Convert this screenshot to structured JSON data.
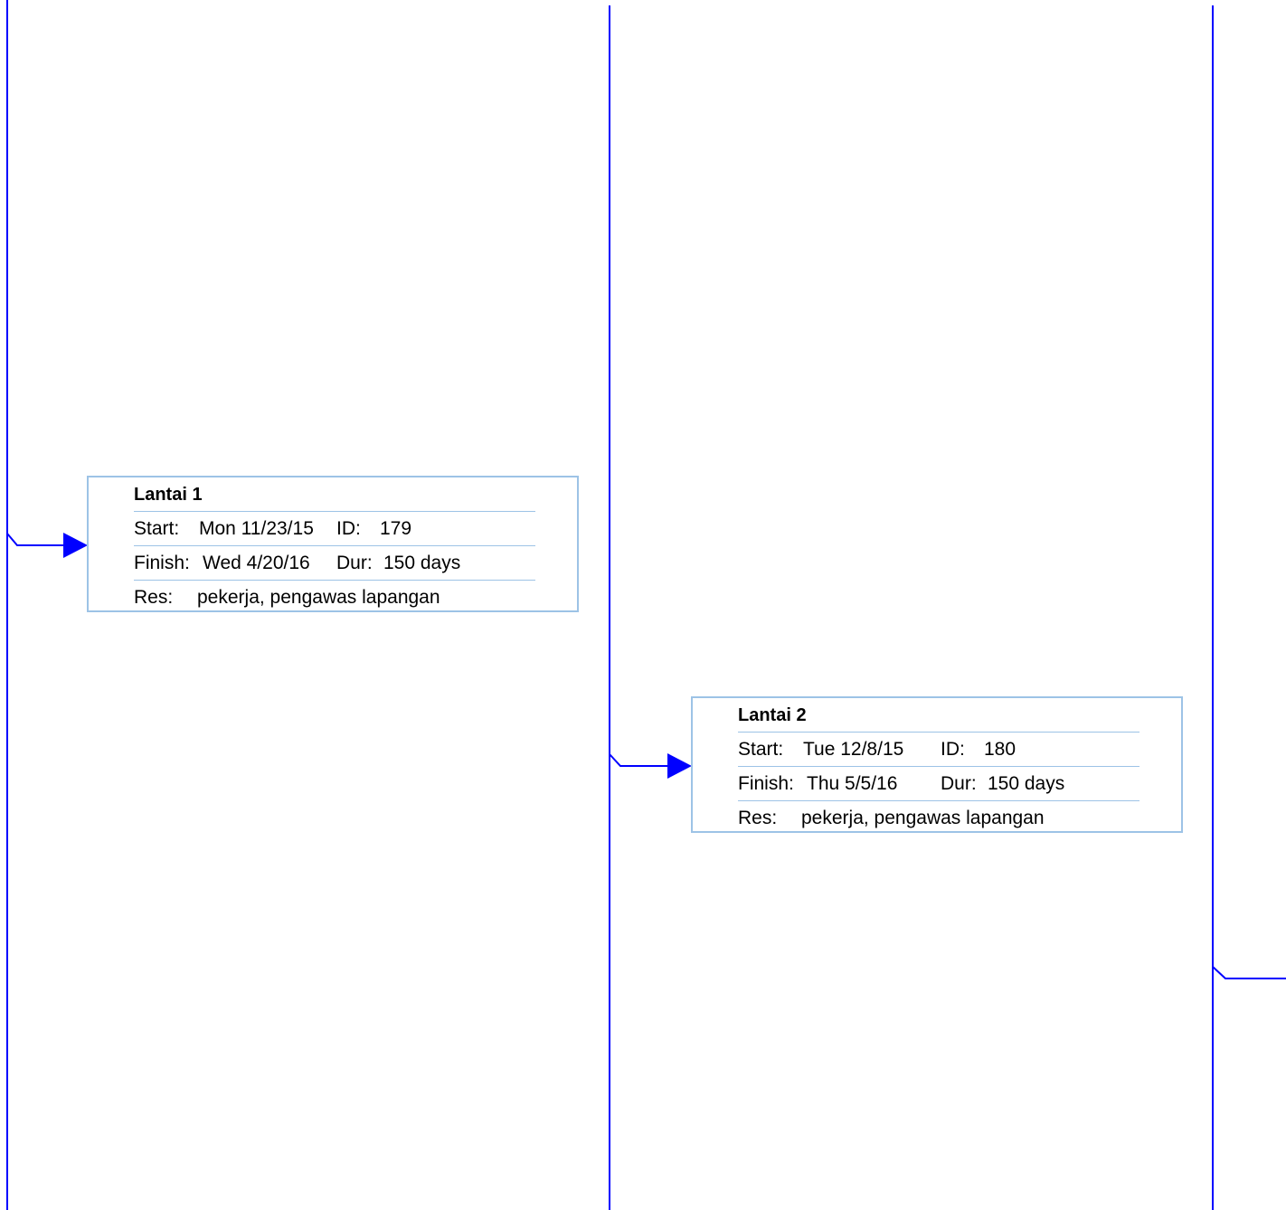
{
  "colors": {
    "connector": "#0000ff",
    "node_border": "#9dc3e6",
    "text": "#000000",
    "background": "#ffffff"
  },
  "nodes": [
    {
      "title": "Lantai 1",
      "start_label": "Start:",
      "start_value": "Mon 11/23/15",
      "id_label": "ID:",
      "id_value": "179",
      "finish_label": "Finish:",
      "finish_value": "Wed 4/20/16",
      "dur_label": "Dur:",
      "dur_value": "150 days",
      "res_label": "Res:",
      "res_value": "pekerja, pengawas lapangan"
    },
    {
      "title": "Lantai 2",
      "start_label": "Start:",
      "start_value": "Tue 12/8/15",
      "id_label": "ID:",
      "id_value": "180",
      "finish_label": "Finish:",
      "finish_value": "Thu 5/5/16",
      "dur_label": "Dur:",
      "dur_value": "150 days",
      "res_label": "Res:",
      "res_value": "pekerja, pengawas lapangan"
    }
  ]
}
